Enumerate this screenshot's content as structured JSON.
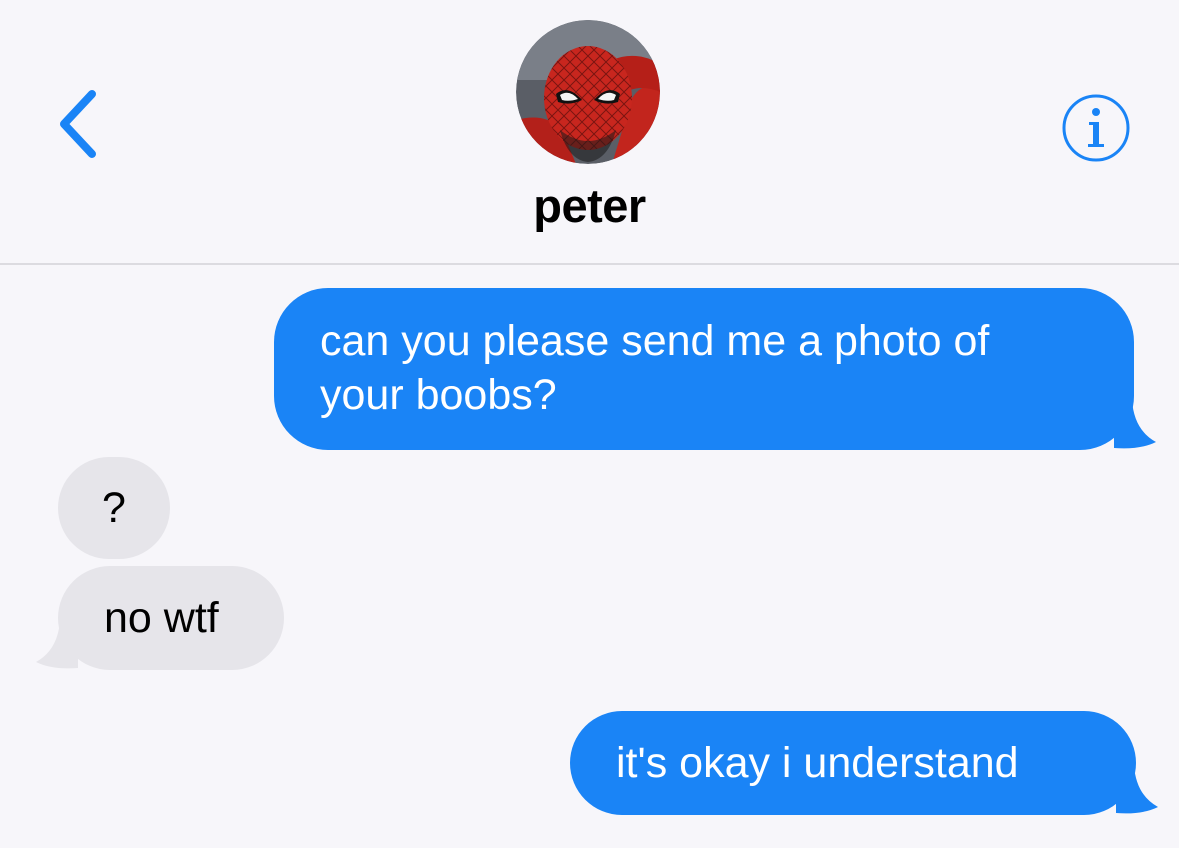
{
  "header": {
    "contact_name": "peter",
    "back_icon": "chevron-left-icon",
    "info_icon": "info-icon",
    "avatar": "spider-man-avatar"
  },
  "colors": {
    "accent": "#1a84f6",
    "sent_bubble": "#1a84f6",
    "received_bubble": "#e6e5ea",
    "background": "#f7f6fa"
  },
  "messages": [
    {
      "direction": "sent",
      "lines": [
        "can you please send me a photo of",
        "your boobs?"
      ]
    },
    {
      "direction": "received",
      "text": "?"
    },
    {
      "direction": "received",
      "text": "no wtf"
    },
    {
      "direction": "sent",
      "text": "it's okay i understand"
    }
  ]
}
